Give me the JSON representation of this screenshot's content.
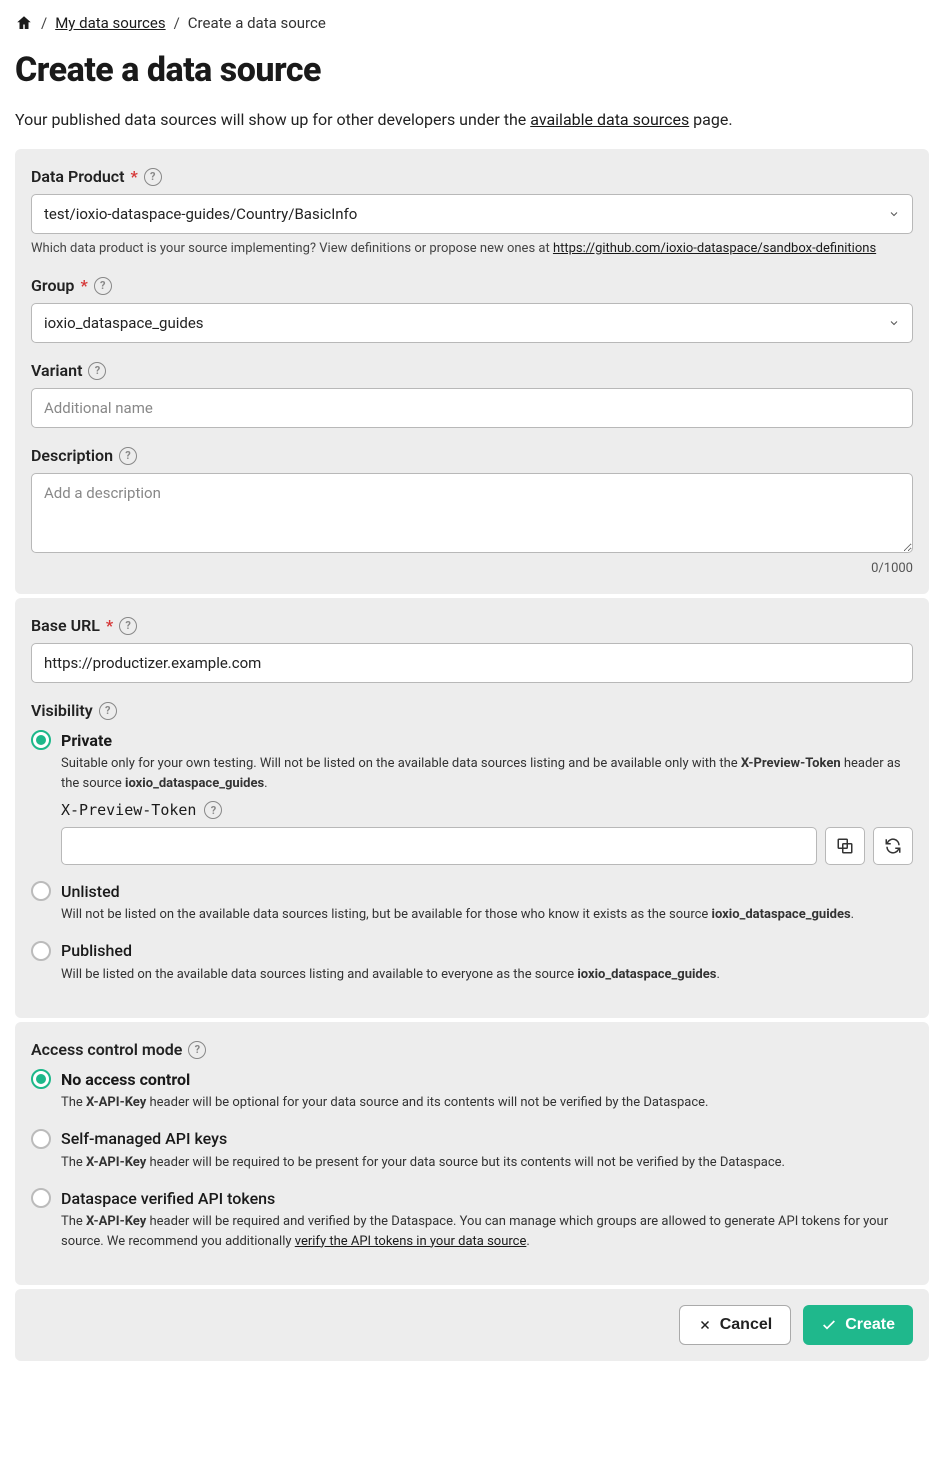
{
  "breadcrumb": {
    "home_aria": "Home",
    "my_sources": "My data sources",
    "current": "Create a data source"
  },
  "title": "Create a data source",
  "intro_pre": "Your published data sources will show up for other developers under the ",
  "intro_link": "available data sources",
  "intro_post": " page.",
  "data_product": {
    "label": "Data Product",
    "value": "test/ioxio-dataspace-guides/Country/BasicInfo",
    "helper_pre": "Which data product is your source implementing? View definitions or propose new ones at ",
    "helper_link": "https://github.com/ioxio-dataspace/sandbox-definitions"
  },
  "group": {
    "label": "Group",
    "value": "ioxio_dataspace_guides"
  },
  "variant": {
    "label": "Variant",
    "placeholder": "Additional name"
  },
  "description": {
    "label": "Description",
    "placeholder": "Add a description",
    "counter": "0/1000"
  },
  "base_url": {
    "label": "Base URL",
    "value": "https://productizer.example.com"
  },
  "visibility": {
    "label": "Visibility",
    "private": {
      "label": "Private",
      "desc_pre": "Suitable only for your own testing. Will not be listed on the available data sources listing and be available only with the ",
      "desc_b1": "X-Preview-Token",
      "desc_mid": " header as the source ",
      "desc_b2": "ioxio_dataspace_guides",
      "desc_post": ".",
      "token_label": "X-Preview-Token"
    },
    "unlisted": {
      "label": "Unlisted",
      "desc_pre": "Will not be listed on the available data sources listing, but be available for those who know it exists as the source ",
      "desc_b": "ioxio_dataspace_guides",
      "desc_post": "."
    },
    "published": {
      "label": "Published",
      "desc_pre": "Will be listed on the available data sources listing and available to everyone as the source ",
      "desc_b": "ioxio_dataspace_guides",
      "desc_post": "."
    }
  },
  "access": {
    "label": "Access control mode",
    "none": {
      "label": "No access control",
      "desc_pre": "The ",
      "desc_b": "X-API-Key",
      "desc_post": " header will be optional for your data source and its contents will not be verified by the Dataspace."
    },
    "self": {
      "label": "Self-managed API keys",
      "desc_pre": "The ",
      "desc_b": "X-API-Key",
      "desc_post": " header will be required to be present for your data source but its contents will not be verified by the Dataspace."
    },
    "verified": {
      "label": "Dataspace verified API tokens",
      "desc_pre": "The ",
      "desc_b": "X-API-Key",
      "desc_mid": " header will be required and verified by the Dataspace. You can manage which groups are allowed to generate API tokens for your source. We recommend you additionally ",
      "desc_link": "verify the API tokens in your data source",
      "desc_post": "."
    }
  },
  "buttons": {
    "cancel": "Cancel",
    "create": "Create"
  }
}
